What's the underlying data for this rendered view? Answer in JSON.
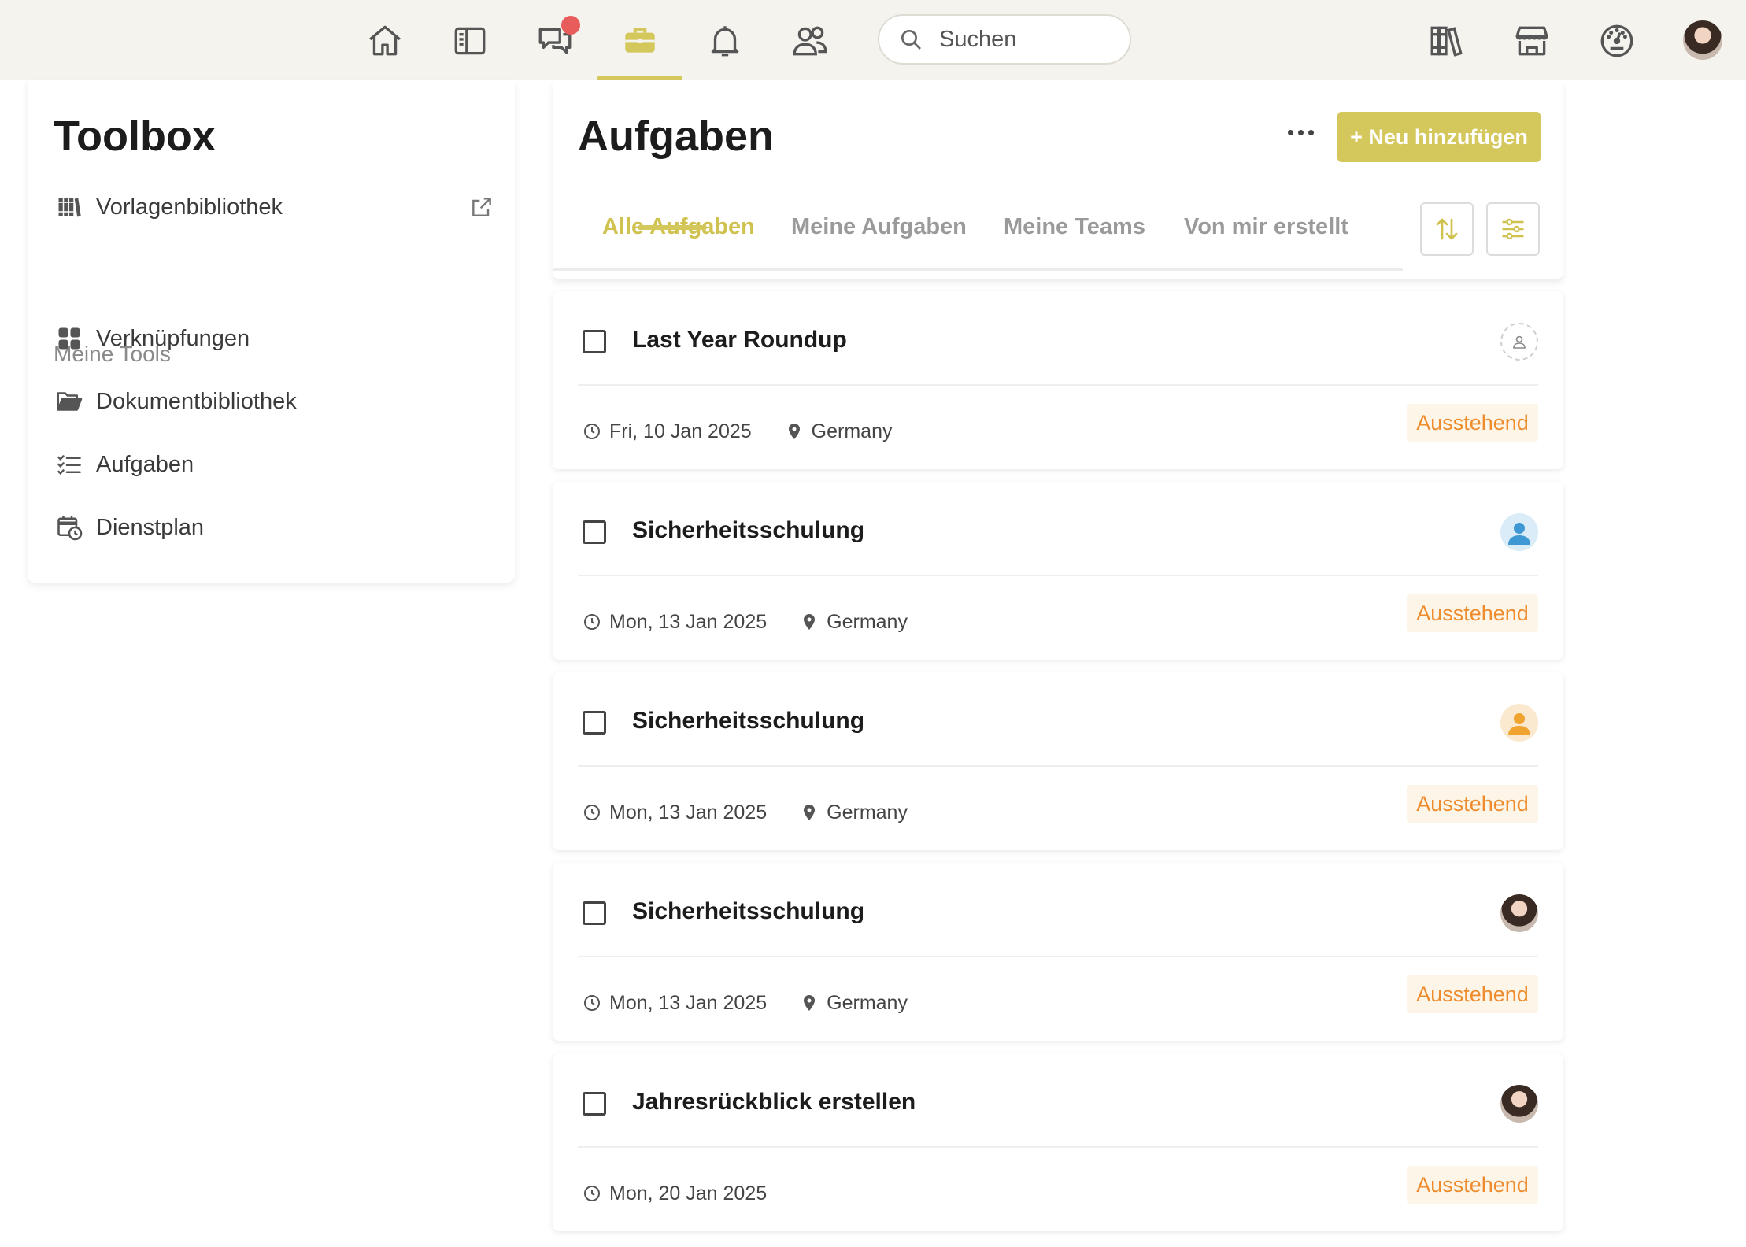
{
  "colors": {
    "accent": "#d4c75c",
    "status_pending": "#ee8b2c",
    "notification": "#e85c5c"
  },
  "topnav": {
    "icons": [
      "home-icon",
      "sidebar-panel-icon",
      "chat-icon",
      "briefcase-icon",
      "bell-icon",
      "users-icon"
    ],
    "active": "briefcase-icon",
    "search_placeholder": "Suchen",
    "right_icons": [
      "library-icon",
      "store-icon",
      "dashboard-icon"
    ]
  },
  "sidebar": {
    "title": "Toolbox",
    "template_library": "Vorlagenbibliothek",
    "section_label": "Meine Tools",
    "items": [
      {
        "label": "Verknüpfungen",
        "icon": "grid-icon"
      },
      {
        "label": "Dokumentbibliothek",
        "icon": "folder-icon"
      },
      {
        "label": "Aufgaben",
        "icon": "checklist-icon"
      },
      {
        "label": "Dienstplan",
        "icon": "calendar-clock-icon"
      }
    ]
  },
  "main": {
    "title": "Aufgaben",
    "add_button": "+ Neu hinzufügen",
    "tabs": [
      "Alle Aufgaben",
      "Meine Aufgaben",
      "Meine Teams",
      "Von mir erstellt"
    ],
    "active_tab": "Alle Aufgaben"
  },
  "tasks": [
    {
      "name": "Last Year Roundup",
      "date": "Fri, 10 Jan 2025",
      "location": "Germany",
      "status": "Ausstehend",
      "assignee": "unassigned"
    },
    {
      "name": "Sicherheitsschulung",
      "date": "Mon, 13 Jan 2025",
      "location": "Germany",
      "status": "Ausstehend",
      "assignee": "blue-user"
    },
    {
      "name": "Sicherheitsschulung",
      "date": "Mon, 13 Jan 2025",
      "location": "Germany",
      "status": "Ausstehend",
      "assignee": "orange-user"
    },
    {
      "name": "Sicherheitsschulung",
      "date": "Mon, 13 Jan 2025",
      "location": "Germany",
      "status": "Ausstehend",
      "assignee": "photo"
    },
    {
      "name": "Jahresrückblick erstellen",
      "date": "Mon, 20 Jan 2025",
      "location": "",
      "status": "Ausstehend",
      "assignee": "photo"
    }
  ]
}
